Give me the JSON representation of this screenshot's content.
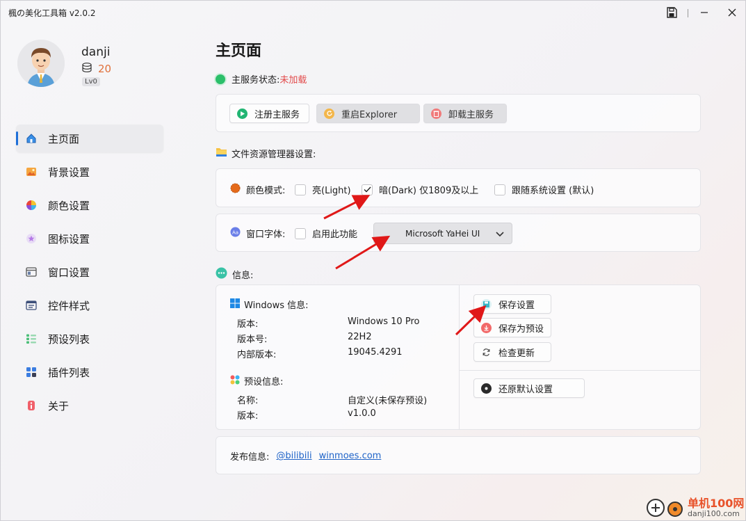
{
  "app": {
    "title": "楓の美化工具箱 v2.0.2"
  },
  "user": {
    "name": "danji",
    "coins": "20",
    "level": "Lv0"
  },
  "sidebar": {
    "items": [
      {
        "label": "主页面",
        "icon": "home-icon",
        "active": true
      },
      {
        "label": "背景设置",
        "icon": "image-icon"
      },
      {
        "label": "颜色设置",
        "icon": "color-wheel-icon"
      },
      {
        "label": "图标设置",
        "icon": "star-icon"
      },
      {
        "label": "窗口设置",
        "icon": "window-icon"
      },
      {
        "label": "控件样式",
        "icon": "controls-icon"
      },
      {
        "label": "预设列表",
        "icon": "list-icon"
      },
      {
        "label": "插件列表",
        "icon": "plugins-icon"
      },
      {
        "label": "关于",
        "icon": "info-icon"
      }
    ]
  },
  "main": {
    "title": "主页面",
    "service_status_label": "主服务状态:",
    "service_status_value": "未加载",
    "service_buttons": {
      "register": "注册主服务",
      "restart": "重启Explorer",
      "unload": "卸载主服务"
    },
    "explorer_settings_label": "文件资源管理器设置:",
    "color_mode": {
      "label": "颜色模式:",
      "light": "亮(Light)",
      "dark": "暗(Dark) 仅1809及以上",
      "system": "跟随系统设置 (默认)",
      "selected": "dark"
    },
    "window_font": {
      "label": "窗口字体:",
      "enable_label": "启用此功能",
      "enabled": false,
      "selected_font": "Microsoft YaHei UI"
    },
    "info_label": "信息:",
    "windows_info": {
      "title": "Windows 信息:",
      "rows": [
        {
          "key": "版本:",
          "value": "Windows 10 Pro"
        },
        {
          "key": "版本号:",
          "value": "22H2"
        },
        {
          "key": "内部版本:",
          "value": "19045.4291"
        }
      ]
    },
    "preset_info": {
      "title": "预设信息:",
      "rows": [
        {
          "key": "名称:",
          "value": "自定义(未保存预设)"
        },
        {
          "key": "版本:",
          "value": "v1.0.0"
        }
      ]
    },
    "actions": {
      "save": "保存设置",
      "save_preset": "保存为预设",
      "check_update": "检查更新",
      "restore_default": "还原默认设置"
    },
    "release": {
      "label": "发布信息:",
      "link1": "@bilibili",
      "link2": "winmoes.com"
    }
  },
  "watermark": {
    "text": "单机100网",
    "url": "danji100.com"
  },
  "colors": {
    "accent": "#1e6fd8",
    "status_error": "#e24b4b",
    "status_ok": "#2bbf6a",
    "coin": "#e0703a"
  }
}
